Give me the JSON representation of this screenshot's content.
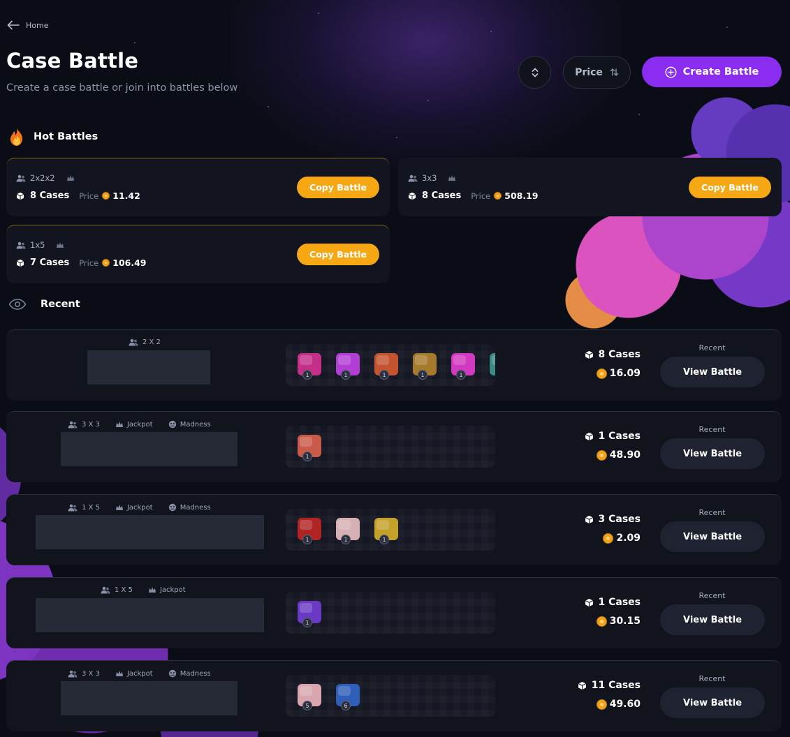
{
  "breadcrumb": {
    "label": "Home"
  },
  "header": {
    "title": "Case Battle",
    "subtitle": "Create a case battle or join into battles below",
    "price_sort_label": "Price",
    "create_label": "Create Battle"
  },
  "colors": {
    "accent": "#8a2df0",
    "copy": "#f5a813",
    "coin": "#f0a21c",
    "background": "#0b0d16"
  },
  "hot": {
    "title": "Hot Battles",
    "cards": [
      {
        "mode": "2x2x2",
        "cases": "8 Cases",
        "price_label": "Price",
        "price": "11.42",
        "button": "Copy Battle"
      },
      {
        "mode": "3x3",
        "cases": "8 Cases",
        "price_label": "Price",
        "price": "508.19",
        "button": "Copy Battle"
      },
      {
        "mode": "1x5",
        "cases": "7 Cases",
        "price_label": "Price",
        "price": "106.49",
        "button": "Copy Battle"
      }
    ]
  },
  "recent": {
    "title": "Recent",
    "rows": [
      {
        "mode": "2 X 2",
        "tags": [],
        "cases": "8 Cases",
        "price": "16.09",
        "status": "Recent",
        "button": "View Battle",
        "thumbs": [
          {
            "qty": "1",
            "color": "#c42f8a"
          },
          {
            "qty": "1",
            "color": "#b23ed6"
          },
          {
            "qty": "1",
            "color": "#c4532f"
          },
          {
            "qty": "1",
            "color": "#a57a2c"
          },
          {
            "qty": "1",
            "color": "#d139c0"
          },
          {
            "qty": "",
            "color": "#3a8a86"
          }
        ]
      },
      {
        "mode": "3 X 3",
        "tags": [
          "Jackpot",
          "Madness"
        ],
        "cases": "1 Cases",
        "price": "48.90",
        "status": "Recent",
        "button": "View Battle",
        "thumbs": [
          {
            "qty": "1",
            "color": "#c85a4a"
          }
        ]
      },
      {
        "mode": "1 X 5",
        "tags": [
          "Jackpot",
          "Madness"
        ],
        "cases": "3 Cases",
        "price": "2.09",
        "status": "Recent",
        "button": "View Battle",
        "thumbs": [
          {
            "qty": "1",
            "color": "#b02424"
          },
          {
            "qty": "1",
            "color": "#d6b0b4"
          },
          {
            "qty": "1",
            "color": "#c4a22a"
          }
        ]
      },
      {
        "mode": "1 X 5",
        "tags": [
          "Jackpot"
        ],
        "cases": "1 Cases",
        "price": "30.15",
        "status": "Recent",
        "button": "View Battle",
        "thumbs": [
          {
            "qty": "1",
            "color": "#6a3ac4"
          }
        ]
      },
      {
        "mode": "3 X 3",
        "tags": [
          "Jackpot",
          "Madness"
        ],
        "cases": "11 Cases",
        "price": "49.60",
        "status": "Recent",
        "button": "View Battle",
        "thumbs": [
          {
            "qty": "5",
            "color": "#d9a6b0"
          },
          {
            "qty": "6",
            "color": "#2e5eb8"
          }
        ]
      }
    ]
  }
}
